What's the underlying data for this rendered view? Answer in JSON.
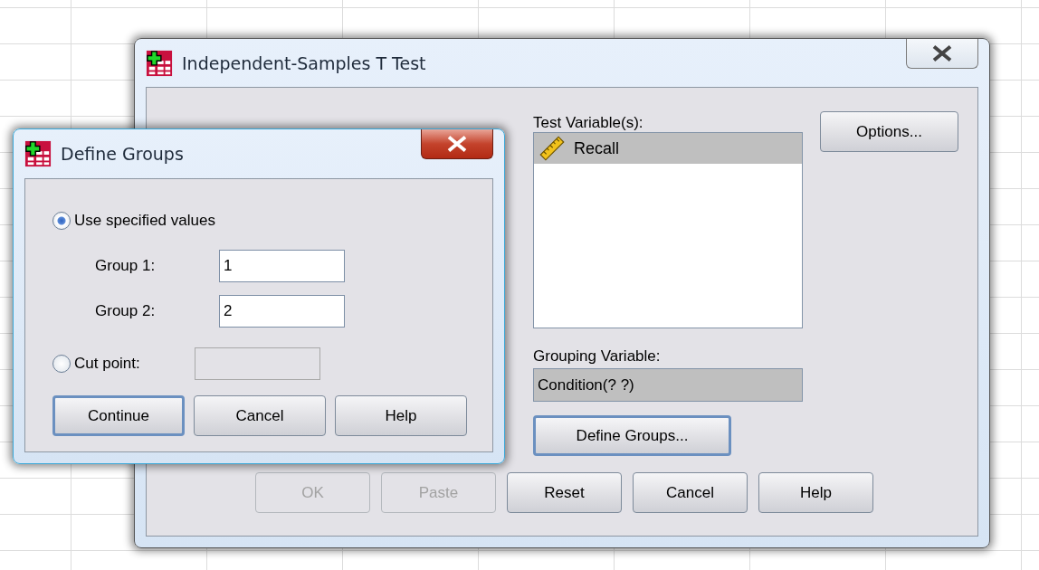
{
  "main_window": {
    "title": "Independent-Samples T Test",
    "active": false,
    "test_variables": {
      "label": "Test Variable(s):",
      "items": [
        {
          "name": "Recall",
          "selected": true
        }
      ]
    },
    "options_button": {
      "label": "Options...",
      "default": false
    },
    "grouping_variable": {
      "label": "Grouping Variable:",
      "value": "Condition(? ?)"
    },
    "define_groups_button": {
      "label": "Define Groups...",
      "default": true
    },
    "buttons": [
      {
        "label": "OK",
        "disabled": true,
        "default": false
      },
      {
        "label": "Paste",
        "disabled": true,
        "default": false
      },
      {
        "label": "Reset",
        "disabled": false,
        "default": false
      },
      {
        "label": "Cancel",
        "disabled": false,
        "default": false
      },
      {
        "label": "Help",
        "disabled": false,
        "default": false
      }
    ]
  },
  "define_groups_dialog": {
    "title": "Define Groups",
    "active": true,
    "options": [
      {
        "kind": "radio",
        "label": "Use specified values",
        "selected": true
      },
      {
        "kind": "field",
        "label": "Group 1:",
        "value": "1",
        "disabled": false
      },
      {
        "kind": "field",
        "label": "Group 2:",
        "value": "2",
        "disabled": false
      },
      {
        "kind": "radio_field",
        "label": "Cut point:",
        "selected": false,
        "disabled": true
      }
    ],
    "buttons": [
      {
        "label": "Continue",
        "disabled": false,
        "default": true
      },
      {
        "label": "Cancel",
        "disabled": false,
        "default": false
      },
      {
        "label": "Help",
        "disabled": false,
        "default": false
      }
    ]
  }
}
